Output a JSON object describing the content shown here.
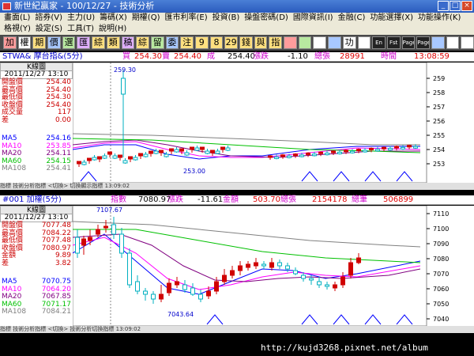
{
  "window": {
    "title": "新世紀贏家 - 100/12/27 - 技術分析"
  },
  "menu": {
    "row1": [
      "畫面(L)",
      "諮券(V)",
      "主力(U)",
      "籌碼(X)",
      "期權(Q)",
      "匯市利率(E)",
      "投資(B)",
      "操盤密碼(D)",
      "國際資訊(I)",
      "金融(C)",
      "功能選擇(X)",
      "功能操作(K)"
    ],
    "row2": [
      "格視(Y)",
      "設定(S)",
      "工具(T)",
      "說明(H)"
    ]
  },
  "toolbar": {
    "buttons": [
      "加",
      "權",
      "期",
      "價",
      "選",
      "匯",
      "綜",
      "類",
      "稿",
      "綜",
      "留",
      "委",
      "注",
      "9",
      "8",
      "29",
      "錢",
      "與",
      "指",
      "",
      "",
      "",
      "",
      "功",
      "",
      "En",
      "Fst",
      "Page",
      "Page",
      "",
      "",
      ""
    ]
  },
  "top": {
    "header": {
      "symbol": "STWA& 摩台指&(5分)",
      "buy_label": "買",
      "buy": "254.30",
      "sell_label": "賣",
      "sell": "254.40",
      "deal_label": "成",
      "deal": "254.40",
      "chg_label": "漲跌",
      "chg": "-1.10",
      "vol_label": "總張",
      "vol": "28991",
      "time_label": "時間",
      "time": "13:08:59"
    },
    "info": {
      "title": "K線圖",
      "date": "2011/12/27 13:10",
      "rows": [
        {
          "l": "開盤價",
          "v": "254.40"
        },
        {
          "l": "最高價",
          "v": "254.40"
        },
        {
          "l": "最低價",
          "v": "254.30"
        },
        {
          "l": "收盤價",
          "v": "254.40"
        },
        {
          "l": "成交量",
          "v": "117"
        },
        {
          "l": "差",
          "v": "0.00"
        }
      ],
      "ma": [
        {
          "l": "MA5",
          "v": "254.16"
        },
        {
          "l": "MA10",
          "v": "253.85"
        },
        {
          "l": "MA20",
          "v": "254.11"
        },
        {
          "l": "MA60",
          "v": "254.15"
        },
        {
          "l": "MA108",
          "v": "254.41"
        }
      ]
    },
    "yticks": [
      "259",
      "258",
      "257",
      "256",
      "255",
      "254",
      "253"
    ],
    "high_label": "259.30",
    "low_label": "253.00",
    "day_label": "27",
    "status": "指標  技術分析指標  <切換> 切換顯示指標  13:09:02"
  },
  "bottom": {
    "header": {
      "symbol": "#001 加權(5分)",
      "idx_label": "指數",
      "idx": "7080.97",
      "chg_label": "漲跌",
      "chg": "-11.61",
      "amt_label": "金額",
      "amt": "503.70",
      "vol_label": "總張",
      "vol": "2154178",
      "tot_label": "總筆",
      "tot": "506899"
    },
    "info": {
      "title": "K線圖",
      "date": "2011/12/27 13:10",
      "rows": [
        {
          "l": "開盤價",
          "v": "7077.48"
        },
        {
          "l": "最高價",
          "v": "7084.22"
        },
        {
          "l": "最低價",
          "v": "7077.48"
        },
        {
          "l": "收盤價",
          "v": "7080.97"
        },
        {
          "l": "金額",
          "v": "9.89"
        },
        {
          "l": "差",
          "v": "3.82"
        }
      ],
      "ma": [
        {
          "l": "MA5",
          "v": "7070.75"
        },
        {
          "l": "MA10",
          "v": "7064.20"
        },
        {
          "l": "MA20",
          "v": "7067.85"
        },
        {
          "l": "MA60",
          "v": "7071.17"
        },
        {
          "l": "MA108",
          "v": "7084.21"
        }
      ]
    },
    "yticks": [
      "7110",
      "7100",
      "7090",
      "7080",
      "7070",
      "7060",
      "7050",
      "7040"
    ],
    "high_label": "7107.67",
    "low_label": "7043.64",
    "day_label": "27",
    "status": "指標  技術分析指標  <切換> 技術分析切換指標  13:09:02"
  },
  "footer": {
    "watermark": "http://kujd3268.pixnet.net/album"
  },
  "colors": {
    "up": "#d00000",
    "down": "#00b0c0",
    "ma5": "#0000ff",
    "ma10": "#ff00ff",
    "ma20": "#800080",
    "ma60": "#00c000",
    "ma108": "#808080"
  }
}
